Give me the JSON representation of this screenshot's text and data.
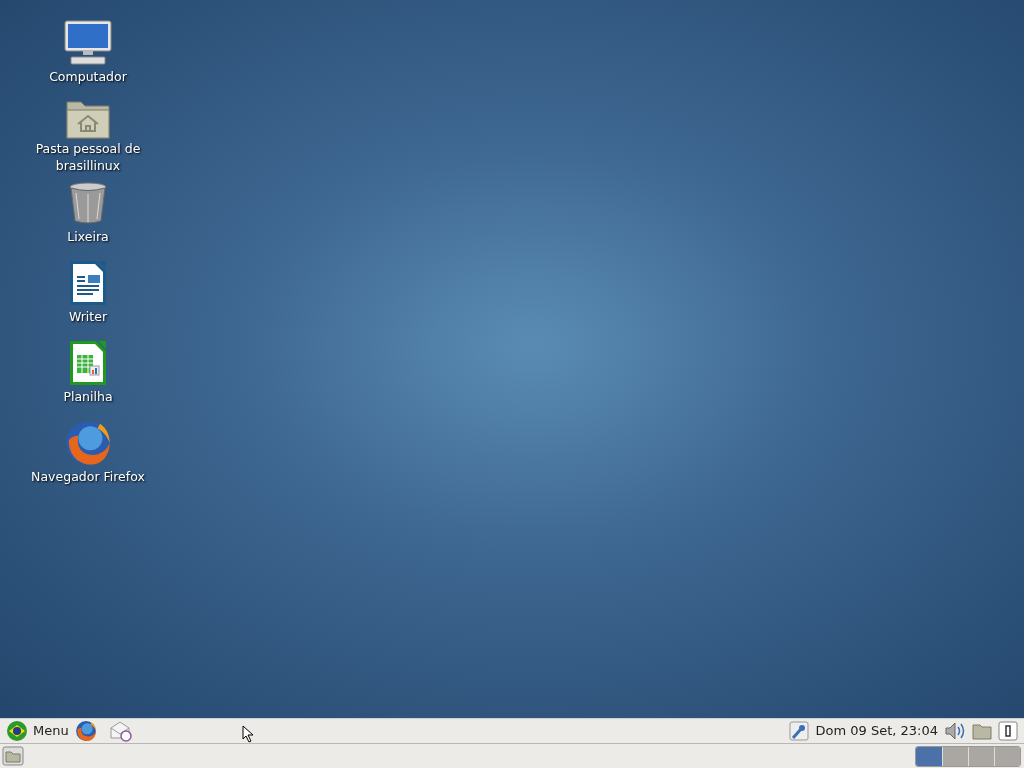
{
  "desktop_icons": [
    {
      "kind": "computer",
      "label": "Computador"
    },
    {
      "kind": "home",
      "label": "Pasta pessoal de brasillinux"
    },
    {
      "kind": "trash",
      "label": "Lixeira"
    },
    {
      "kind": "writer",
      "label": "Writer"
    },
    {
      "kind": "calc",
      "label": "Planilha"
    },
    {
      "kind": "firefox",
      "label": "Navegador Firefox"
    }
  ],
  "top_panel": {
    "menu_label": "Menu",
    "clock": "Dom 09 Set, 23:04"
  },
  "workspaces": [
    {
      "selected": true
    },
    {
      "selected": false
    },
    {
      "selected": false
    },
    {
      "selected": false
    }
  ]
}
